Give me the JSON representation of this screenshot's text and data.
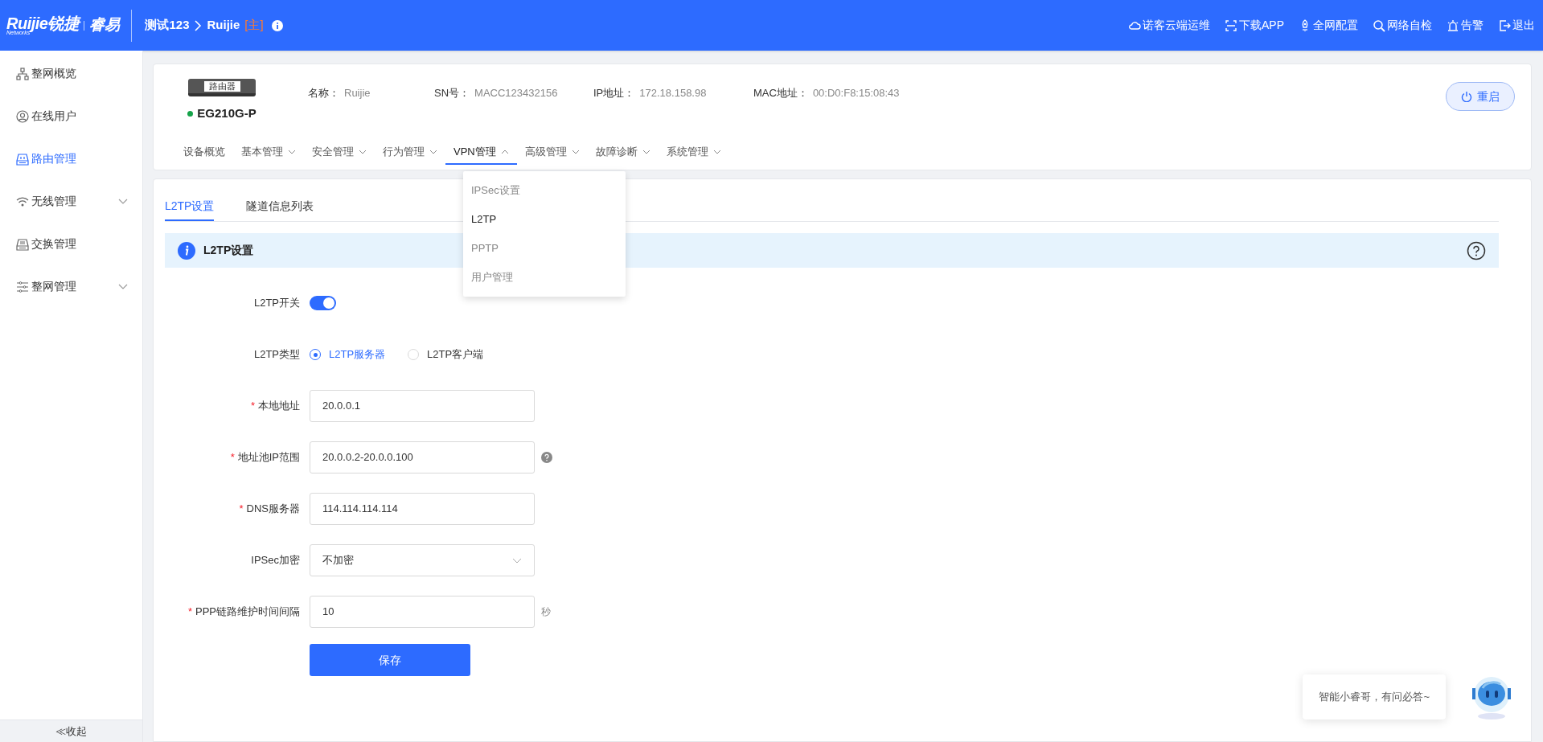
{
  "header": {
    "logo": {
      "brand": "Ruijie锐捷",
      "sub": "Networks",
      "product": "睿易"
    },
    "breadcrumb": [
      "测试123",
      "Ruijie"
    ],
    "role_tag": "[主]",
    "actions": [
      {
        "label": "诺客云端运维"
      },
      {
        "label": "下载APP"
      },
      {
        "label": "全网配置"
      },
      {
        "label": "网络自检"
      },
      {
        "label": "告警"
      },
      {
        "label": "退出"
      }
    ]
  },
  "sidebar": {
    "items": [
      {
        "label": "整网概览",
        "selected": false,
        "expandable": false
      },
      {
        "label": "在线用户",
        "selected": false,
        "expandable": false
      },
      {
        "label": "路由管理",
        "selected": true,
        "expandable": false
      },
      {
        "label": "无线管理",
        "selected": false,
        "expandable": true
      },
      {
        "label": "交换管理",
        "selected": false,
        "expandable": false
      },
      {
        "label": "整网管理",
        "selected": false,
        "expandable": true
      }
    ],
    "collapse": "≪收起"
  },
  "device": {
    "badge": "路由器",
    "model": "EG210G-P",
    "online": true,
    "fields": [
      {
        "label": "名称：",
        "value": "Ruijie"
      },
      {
        "label": "SN号：",
        "value": "MACC123432156"
      },
      {
        "label": "IP地址：",
        "value": "172.18.158.98"
      },
      {
        "label": "MAC地址：",
        "value": "00:D0:F8:15:08:43"
      }
    ],
    "reboot": "重启"
  },
  "nav": [
    {
      "label": "设备概览",
      "selected": false,
      "dropdown": false
    },
    {
      "label": "基本管理",
      "selected": false,
      "dropdown": true
    },
    {
      "label": "安全管理",
      "selected": false,
      "dropdown": true
    },
    {
      "label": "行为管理",
      "selected": false,
      "dropdown": true
    },
    {
      "label": "VPN管理",
      "selected": true,
      "dropdown": true
    },
    {
      "label": "高级管理",
      "selected": false,
      "dropdown": true
    },
    {
      "label": "故障诊断",
      "selected": false,
      "dropdown": true
    },
    {
      "label": "系统管理",
      "selected": false,
      "dropdown": true
    }
  ],
  "vpn_menu": [
    {
      "label": "IPSec设置",
      "selected": false
    },
    {
      "label": "L2TP",
      "selected": true
    },
    {
      "label": "PPTP",
      "selected": false
    },
    {
      "label": "用户管理",
      "selected": false
    }
  ],
  "tabs": [
    {
      "label": "L2TP设置",
      "selected": true
    },
    {
      "label": "隧道信息列表",
      "selected": false
    }
  ],
  "section_title": "L2TP设置",
  "form": [
    {
      "kind": "toggle",
      "label": "L2TP开关",
      "on": true
    },
    {
      "kind": "radio",
      "label": "L2TP类型",
      "options": [
        {
          "label": "L2TP服务器",
          "selected": true
        },
        {
          "label": "L2TP客户端",
          "selected": false
        }
      ]
    },
    {
      "kind": "input",
      "required_mark": "*",
      "label": "本地地址",
      "value": "20.0.0.1"
    },
    {
      "kind": "input",
      "required_mark": "*",
      "label": "地址池IP范围",
      "value": "20.0.0.2-20.0.0.100",
      "help": true
    },
    {
      "kind": "input",
      "required_mark": "*",
      "label": "DNS服务器",
      "value": "114.114.114.114"
    },
    {
      "kind": "select",
      "label": "IPSec加密",
      "value": "不加密"
    },
    {
      "kind": "input",
      "required_mark": "*",
      "label": "PPP链路维护时间间隔",
      "value": "10",
      "suffix": "秒"
    }
  ],
  "save": "保存",
  "assistant": {
    "message": "智能小睿哥，有问必答~"
  }
}
